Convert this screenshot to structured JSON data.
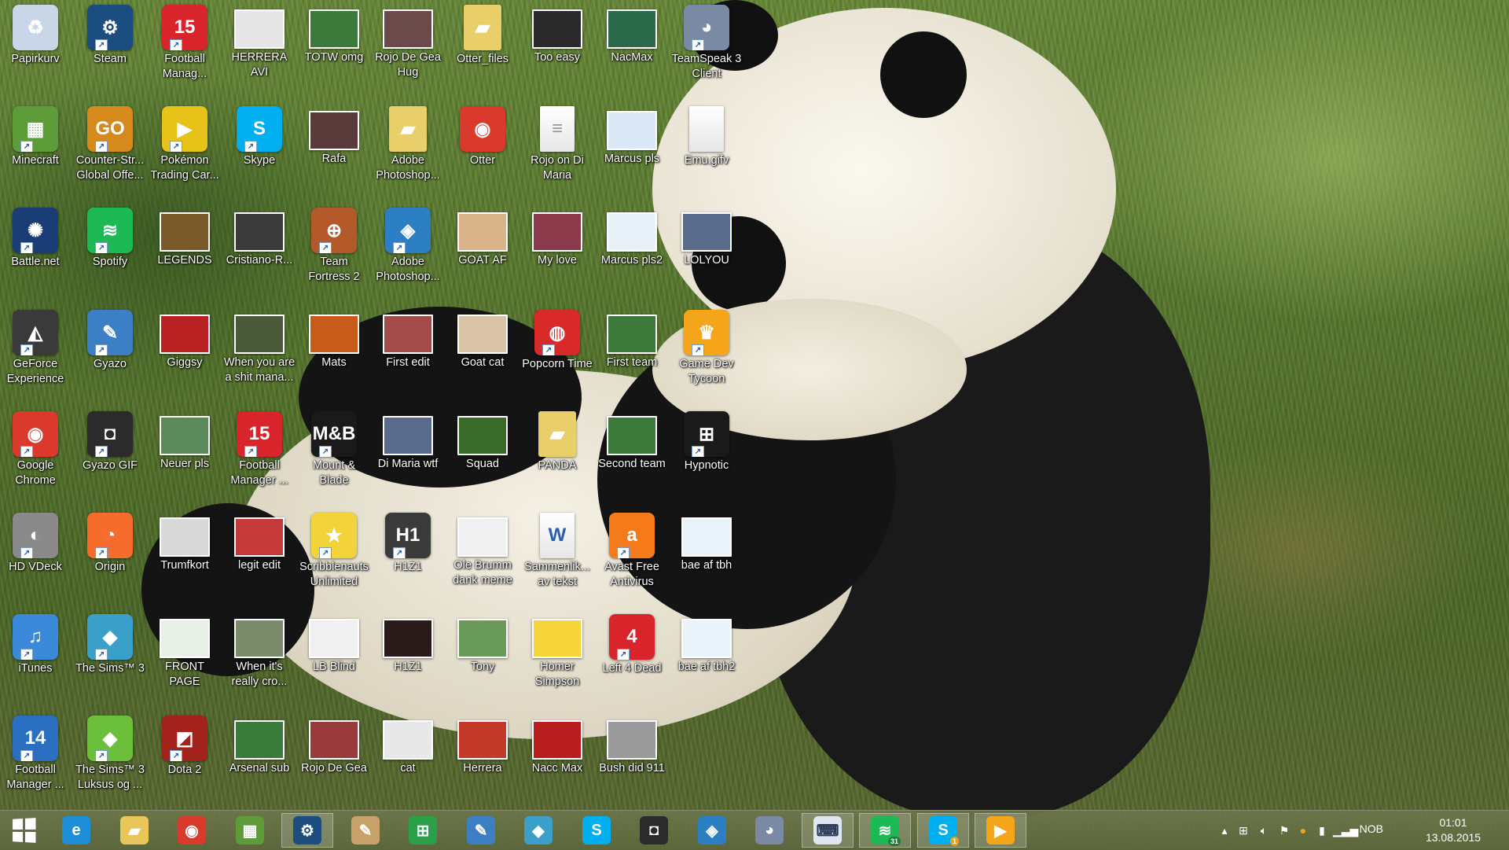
{
  "desktop": {
    "columns": [
      [
        {
          "label": "Papirkurv",
          "icon": "recycle-bin-icon",
          "color": "#c9d6e8",
          "kind": "app"
        },
        {
          "label": "Minecraft",
          "icon": "minecraft-icon",
          "color": "#5e9c3a",
          "kind": "shortcut"
        },
        {
          "label": "Battle.net",
          "icon": "battlenet-icon",
          "color": "#1b3d75",
          "kind": "shortcut"
        },
        {
          "label": "GeForce Experience",
          "icon": "geforce-icon",
          "color": "#3a3a3a",
          "kind": "shortcut"
        },
        {
          "label": "Google Chrome",
          "icon": "chrome-icon",
          "color": "#d93a2b",
          "kind": "shortcut"
        },
        {
          "label": "HD VDeck",
          "icon": "hd-vdeck-icon",
          "color": "#8a8a8a",
          "kind": "shortcut"
        },
        {
          "label": "iTunes",
          "icon": "itunes-icon",
          "color": "#3b8ad9",
          "kind": "shortcut"
        },
        {
          "label": "Football Manager ...",
          "icon": "football-manager-14-icon",
          "color": "#2a6fc0",
          "kind": "shortcut"
        }
      ],
      [
        {
          "label": "Steam",
          "icon": "steam-icon",
          "color": "#1b4d7e",
          "kind": "shortcut"
        },
        {
          "label": "Counter-Str... Global Offe...",
          "icon": "csgo-icon",
          "color": "#d58a1c",
          "kind": "shortcut"
        },
        {
          "label": "Spotify",
          "icon": "spotify-icon",
          "color": "#1db954",
          "kind": "shortcut"
        },
        {
          "label": "Gyazo",
          "icon": "gyazo-icon",
          "color": "#3c7fc4",
          "kind": "shortcut"
        },
        {
          "label": "Gyazo GIF",
          "icon": "gyazo-gif-icon",
          "color": "#2b2b2b",
          "kind": "shortcut"
        },
        {
          "label": "Origin",
          "icon": "origin-icon",
          "color": "#f56c2d",
          "kind": "shortcut"
        },
        {
          "label": "The Sims™ 3",
          "icon": "sims3-icon",
          "color": "#3aa0c9",
          "kind": "shortcut"
        },
        {
          "label": "The Sims™ 3 Luksus og ...",
          "icon": "sims3-luxury-icon",
          "color": "#6bbf3a",
          "kind": "shortcut"
        }
      ],
      [
        {
          "label": "Football Manag...",
          "icon": "football-manager-15-icon",
          "color": "#d8242a",
          "kind": "shortcut"
        },
        {
          "label": "Pokémon Trading Car...",
          "icon": "pokemon-tcg-icon",
          "color": "#e7c219",
          "kind": "shortcut"
        },
        {
          "label": "LEGENDS",
          "icon": "image-file-icon",
          "color": "#7a5a2a",
          "kind": "photo"
        },
        {
          "label": "Giggsy",
          "icon": "image-file-icon",
          "color": "#b82222",
          "kind": "photo"
        },
        {
          "label": "Neuer pls",
          "icon": "image-file-icon",
          "color": "#5a8a5a",
          "kind": "photo"
        },
        {
          "label": "Trumfkort",
          "icon": "image-file-icon",
          "color": "#d9d9d9",
          "kind": "photo"
        },
        {
          "label": "FRONT PAGE",
          "icon": "image-file-icon",
          "color": "#e8f0e8",
          "kind": "photo"
        },
        {
          "label": "Dota 2",
          "icon": "dota2-icon",
          "color": "#a3221c",
          "kind": "shortcut"
        }
      ],
      [
        {
          "label": "HERRERA AVI",
          "icon": "image-file-icon",
          "color": "#e6e6e6",
          "kind": "photo"
        },
        {
          "label": "Skype",
          "icon": "skype-icon",
          "color": "#00aff0",
          "kind": "shortcut"
        },
        {
          "label": "Cristiano-R...",
          "icon": "image-file-icon",
          "color": "#3a3a3a",
          "kind": "photo"
        },
        {
          "label": "When you are a shit mana...",
          "icon": "image-file-icon",
          "color": "#4a5a3a",
          "kind": "photo"
        },
        {
          "label": "Football Manager ...",
          "icon": "football-manager-15-editor-icon",
          "color": "#d8242a",
          "kind": "shortcut"
        },
        {
          "label": "legit edit",
          "icon": "image-file-icon",
          "color": "#c43a3a",
          "kind": "photo"
        },
        {
          "label": "When it's really cro...",
          "icon": "image-file-icon",
          "color": "#7a8a6a",
          "kind": "photo"
        },
        {
          "label": "Arsenal sub",
          "icon": "image-file-icon",
          "color": "#3a7a3a",
          "kind": "photo"
        }
      ],
      [
        {
          "label": "TOTW omg",
          "icon": "image-file-icon",
          "color": "#3c7a3c",
          "kind": "photo"
        },
        {
          "label": "Rafa",
          "icon": "image-file-icon",
          "color": "#5a3a3a",
          "kind": "photo"
        },
        {
          "label": "Team Fortress 2",
          "icon": "tf2-icon",
          "color": "#b45a2a",
          "kind": "shortcut"
        },
        {
          "label": "Mats",
          "icon": "image-file-icon",
          "color": "#c85a1a",
          "kind": "photo"
        },
        {
          "label": "Mount & Blade",
          "icon": "mount-blade-icon",
          "color": "#1a1a1a",
          "kind": "shortcut"
        },
        {
          "label": "Scribblenauts Unlimited",
          "icon": "scribblenauts-icon",
          "color": "#f2d43a",
          "kind": "shortcut"
        },
        {
          "label": "LB Blind",
          "icon": "image-file-icon",
          "color": "#f0f0f0",
          "kind": "photo"
        },
        {
          "label": "Rojo De Gea",
          "icon": "image-file-icon",
          "color": "#9a3a3a",
          "kind": "photo"
        }
      ],
      [
        {
          "label": "Rojo De Gea Hug",
          "icon": "image-file-icon",
          "color": "#6a4a4a",
          "kind": "photo"
        },
        {
          "label": "Adobe Photoshop...",
          "icon": "folder-icon",
          "color": "#e8cf6a",
          "kind": "folder"
        },
        {
          "label": "Adobe Photoshop...",
          "icon": "photoshop-installer-icon",
          "color": "#2b7fc2",
          "kind": "shortcut"
        },
        {
          "label": "First edit",
          "icon": "image-file-icon",
          "color": "#a34a4a",
          "kind": "photo"
        },
        {
          "label": "Di Maria wtf",
          "icon": "image-file-icon",
          "color": "#5a6a8a",
          "kind": "photo"
        },
        {
          "label": "H1Z1",
          "icon": "h1z1-icon",
          "color": "#3a3a3a",
          "kind": "shortcut"
        },
        {
          "label": "H1Z1",
          "icon": "image-file-icon",
          "color": "#2a1a1a",
          "kind": "photo"
        },
        {
          "label": "cat",
          "icon": "image-file-icon",
          "color": "#e8e8e8",
          "kind": "photo"
        }
      ],
      [
        {
          "label": "Otter_files",
          "icon": "folder-icon",
          "color": "#e8cf6a",
          "kind": "folder"
        },
        {
          "label": "Otter",
          "icon": "chrome-html-icon",
          "color": "#d93a2b",
          "kind": "app"
        },
        {
          "label": "GOAT AF",
          "icon": "image-file-icon",
          "color": "#d9b48a",
          "kind": "photo"
        },
        {
          "label": "Goat cat",
          "icon": "image-file-icon",
          "color": "#d9c4a8",
          "kind": "photo"
        },
        {
          "label": "Squad",
          "icon": "image-file-icon",
          "color": "#3a6a2a",
          "kind": "photo"
        },
        {
          "label": "Ole Brumm dank meme",
          "icon": "image-file-icon",
          "color": "#f0f0f0",
          "kind": "photo"
        },
        {
          "label": "Tony",
          "icon": "image-file-icon",
          "color": "#6a9a5a",
          "kind": "photo"
        },
        {
          "label": "Herrera",
          "icon": "image-file-icon",
          "color": "#c43a2a",
          "kind": "photo"
        }
      ],
      [
        {
          "label": "Too easy",
          "icon": "image-file-icon",
          "color": "#2a2a2a",
          "kind": "photo"
        },
        {
          "label": "Rojo on Di Maria",
          "icon": "document-icon",
          "color": "#f5f5f5",
          "kind": "file"
        },
        {
          "label": "My love",
          "icon": "image-file-icon",
          "color": "#8a3a4a",
          "kind": "photo"
        },
        {
          "label": "Popcorn Time",
          "icon": "popcorn-time-icon",
          "color": "#d92a2a",
          "kind": "shortcut"
        },
        {
          "label": "PANDA",
          "icon": "folder-icon",
          "color": "#e8cf6a",
          "kind": "folder"
        },
        {
          "label": "Sammenlik... av tekst",
          "icon": "word-document-icon",
          "color": "#2b5fad",
          "kind": "file"
        },
        {
          "label": "Homer Simpson",
          "icon": "image-file-icon",
          "color": "#f5d53a",
          "kind": "photo"
        },
        {
          "label": "Nacc Max",
          "icon": "image-file-icon",
          "color": "#b81e1e",
          "kind": "photo"
        }
      ],
      [
        {
          "label": "NacMax",
          "icon": "image-file-icon",
          "color": "#2a6a4a",
          "kind": "photo"
        },
        {
          "label": "Marcus pls",
          "icon": "image-file-icon",
          "color": "#dbe8f5",
          "kind": "photo"
        },
        {
          "label": "Marcus pls2",
          "icon": "image-file-icon",
          "color": "#e8f0f8",
          "kind": "photo"
        },
        {
          "label": "First team",
          "icon": "image-file-icon",
          "color": "#3c7a3c",
          "kind": "photo"
        },
        {
          "label": "Second team",
          "icon": "image-file-icon",
          "color": "#3c7a3c",
          "kind": "photo"
        },
        {
          "label": "Avast Free Antivirus",
          "icon": "avast-icon",
          "color": "#f57a1a",
          "kind": "shortcut"
        },
        {
          "label": "Left 4 Dead",
          "icon": "left4dead-icon",
          "color": "#d8242a",
          "kind": "shortcut"
        },
        {
          "label": "Bush did 911",
          "icon": "image-file-icon",
          "color": "#9a9a9a",
          "kind": "photo"
        }
      ],
      [
        {
          "label": "TeamSpeak 3 Client",
          "icon": "teamspeak-icon",
          "color": "#7a8aa5",
          "kind": "shortcut"
        },
        {
          "label": "Emu.gifv",
          "icon": "blank-file-icon",
          "color": "#f5f5f5",
          "kind": "file"
        },
        {
          "label": "LOLYOU",
          "icon": "image-file-icon",
          "color": "#5a6a8a",
          "kind": "photo"
        },
        {
          "label": "Game Dev Tycoon",
          "icon": "game-dev-tycoon-icon",
          "color": "#f5a51a",
          "kind": "shortcut"
        },
        {
          "label": "Hypnotic",
          "icon": "hypnotic-icon",
          "color": "#1a1a1a",
          "kind": "shortcut"
        },
        {
          "label": "bae af tbh",
          "icon": "image-file-icon",
          "color": "#e8f4fa",
          "kind": "photo"
        },
        {
          "label": "bae af tbh2",
          "icon": "image-file-icon",
          "color": "#e8f4fa",
          "kind": "photo"
        }
      ]
    ],
    "glyphs": {
      "recycle-bin-icon": "♻",
      "minecraft-icon": "▦",
      "battlenet-icon": "✺",
      "geforce-icon": "◭",
      "chrome-icon": "◉",
      "hd-vdeck-icon": "◐",
      "itunes-icon": "♫",
      "football-manager-14-icon": "14",
      "steam-icon": "⚙",
      "csgo-icon": "GO",
      "spotify-icon": "≋",
      "gyazo-icon": "✎",
      "gyazo-gif-icon": "◘",
      "origin-icon": "◔",
      "sims3-icon": "◆",
      "sims3-luxury-icon": "◆",
      "football-manager-15-icon": "15",
      "pokemon-tcg-icon": "▶",
      "dota2-icon": "◩",
      "skype-icon": "S",
      "football-manager-15-editor-icon": "15",
      "tf2-icon": "⊕",
      "mount-blade-icon": "M&B",
      "scribblenauts-icon": "★",
      "folder-icon": "▰",
      "photoshop-installer-icon": "◈",
      "h1z1-icon": "H1",
      "chrome-html-icon": "◉",
      "document-icon": "≡",
      "popcorn-time-icon": "◍",
      "word-document-icon": "W",
      "avast-icon": "a",
      "left4dead-icon": "4",
      "teamspeak-icon": "◕",
      "blank-file-icon": "",
      "game-dev-tycoon-icon": "♛",
      "hypnotic-icon": "⊞",
      "image-file-icon": ""
    }
  },
  "taskbar": {
    "apps": [
      {
        "name": "internet-explorer",
        "glyph": "e",
        "color": "#1e8fd6",
        "active": false
      },
      {
        "name": "file-explorer",
        "glyph": "▰",
        "color": "#e8c65a",
        "active": false
      },
      {
        "name": "chrome",
        "glyph": "◉",
        "color": "#d93a2b",
        "active": false
      },
      {
        "name": "minecraft",
        "glyph": "▦",
        "color": "#5e9c3a",
        "active": false
      },
      {
        "name": "steam",
        "glyph": "⚙",
        "color": "#1b4d7e",
        "active": true
      },
      {
        "name": "paint",
        "glyph": "✎",
        "color": "#c8a26a",
        "active": false
      },
      {
        "name": "windows-store",
        "glyph": "⊞",
        "color": "#2ba04a",
        "active": false
      },
      {
        "name": "gyazo",
        "glyph": "✎",
        "color": "#3c7fc4",
        "active": false
      },
      {
        "name": "sims3",
        "glyph": "◆",
        "color": "#3aa0c9",
        "active": false
      },
      {
        "name": "skype",
        "glyph": "S",
        "color": "#00aff0",
        "active": false
      },
      {
        "name": "gyazo-gif",
        "glyph": "◘",
        "color": "#2b2b2b",
        "active": false
      },
      {
        "name": "photoshop-installer",
        "glyph": "◈",
        "color": "#2b7fc2",
        "active": false
      },
      {
        "name": "teamspeak",
        "glyph": "◕",
        "color": "#7a8aa5",
        "active": false
      },
      {
        "name": "on-screen-keyboard",
        "glyph": "⌨",
        "color": "#dfe8f2",
        "active": true
      },
      {
        "name": "spotify",
        "glyph": "≋",
        "color": "#1db954",
        "active": true,
        "badge": "31"
      },
      {
        "name": "skype-notification",
        "glyph": "S",
        "color": "#00aff0",
        "active": true,
        "badge": "1"
      },
      {
        "name": "media-player",
        "glyph": "▶",
        "color": "#f5a51a",
        "active": true
      }
    ],
    "tray": {
      "language": "NOB",
      "time": "01:01",
      "date": "13.08.2015"
    }
  }
}
